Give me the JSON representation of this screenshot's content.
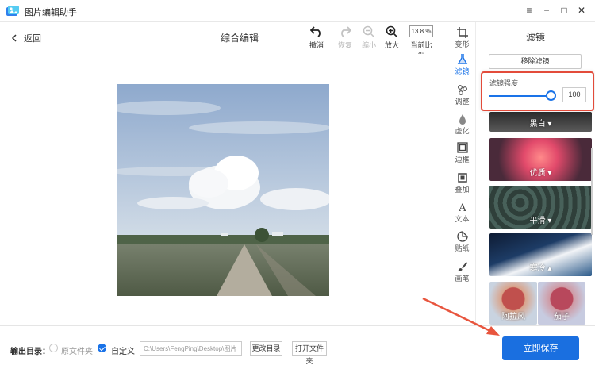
{
  "window": {
    "title": "图片编辑助手",
    "controls": [
      "minimize",
      "restore",
      "maximize",
      "close"
    ]
  },
  "toolbar": {
    "back_label": "返回",
    "page_title": "综合编辑",
    "undo_label": "撤消",
    "redo_label": "恢复",
    "zoom_out_label": "缩小",
    "zoom_in_label": "放大",
    "zoom_value": "13.8 %",
    "current_ratio_label": "当前比例"
  },
  "side_tools": [
    {
      "label": "变形",
      "icon": "crop-icon"
    },
    {
      "label": "滤镜",
      "icon": "flask-icon",
      "active": true
    },
    {
      "label": "调整",
      "icon": "dots-icon"
    },
    {
      "label": "虚化",
      "icon": "drop-icon"
    },
    {
      "label": "边框",
      "icon": "frame-icon"
    },
    {
      "label": "叠加",
      "icon": "layers-icon"
    },
    {
      "label": "文本",
      "icon": "text-icon"
    },
    {
      "label": "贴纸",
      "icon": "sticker-icon"
    },
    {
      "label": "画笔",
      "icon": "brush-icon"
    }
  ],
  "panel": {
    "title": "滤镜",
    "remove_filter_label": "移除滤镜",
    "strength_label": "滤镜强度",
    "strength_value": "100",
    "strength_fraction": 1.0,
    "filters": [
      {
        "label": "黑白",
        "expandable": true
      },
      {
        "label": "优质",
        "expandable": true
      },
      {
        "label": "平滑",
        "expandable": true
      },
      {
        "label": "寒冷",
        "expandable": true,
        "expanded": true
      },
      {
        "label": "阿拉风"
      },
      {
        "label": "茄子"
      }
    ]
  },
  "bottom": {
    "output_label": "输出目录：",
    "option_original": "原文件夹",
    "option_custom": "自定义",
    "selected_option": "自定义",
    "path_value": "C:\\Users\\FengPing\\Desktop\\图片",
    "change_dir_label": "更改目录",
    "open_folder_label": "打开文件夹",
    "save_label": "立即保存"
  },
  "colors": {
    "accent": "#1a6fe0",
    "highlight_box": "#e34b3a",
    "annotation_arrow": "#e8553e"
  }
}
